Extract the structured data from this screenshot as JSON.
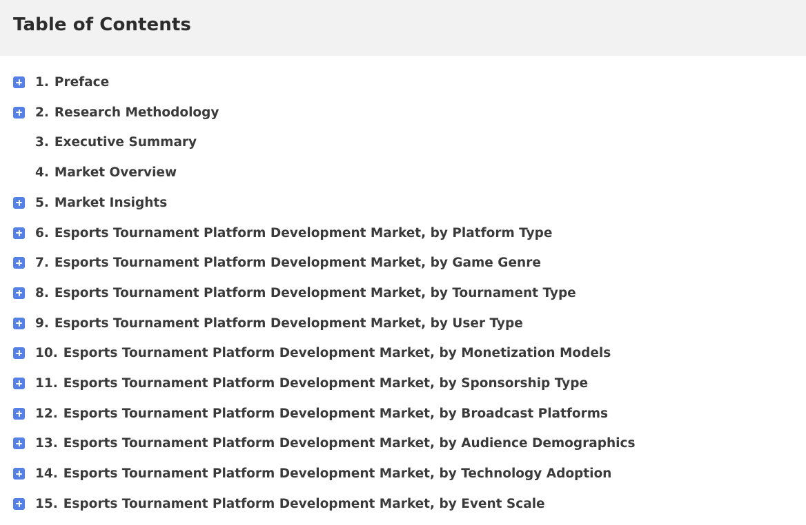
{
  "header": {
    "title": "Table of Contents"
  },
  "toc": {
    "items": [
      {
        "number": "1.",
        "label": "Preface",
        "expandable": true
      },
      {
        "number": "2.",
        "label": "Research Methodology",
        "expandable": true
      },
      {
        "number": "3.",
        "label": "Executive Summary",
        "expandable": false
      },
      {
        "number": "4.",
        "label": "Market Overview",
        "expandable": false
      },
      {
        "number": "5.",
        "label": "Market Insights",
        "expandable": true
      },
      {
        "number": "6.",
        "label": "Esports Tournament Platform Development Market, by Platform Type",
        "expandable": true
      },
      {
        "number": "7.",
        "label": "Esports Tournament Platform Development Market, by Game Genre",
        "expandable": true
      },
      {
        "number": "8.",
        "label": "Esports Tournament Platform Development Market, by Tournament Type",
        "expandable": true
      },
      {
        "number": "9.",
        "label": "Esports Tournament Platform Development Market, by User Type",
        "expandable": true
      },
      {
        "number": "10.",
        "label": "Esports Tournament Platform Development Market, by Monetization Models",
        "expandable": true
      },
      {
        "number": "11.",
        "label": "Esports Tournament Platform Development Market, by Sponsorship Type",
        "expandable": true
      },
      {
        "number": "12.",
        "label": "Esports Tournament Platform Development Market, by Broadcast Platforms",
        "expandable": true
      },
      {
        "number": "13.",
        "label": "Esports Tournament Platform Development Market, by Audience Demographics",
        "expandable": true
      },
      {
        "number": "14.",
        "label": "Esports Tournament Platform Development Market, by Technology Adoption",
        "expandable": true
      },
      {
        "number": "15.",
        "label": "Esports Tournament Platform Development Market, by Event Scale",
        "expandable": true
      }
    ]
  },
  "colors": {
    "expand_button": "#5580e6",
    "header_background": "#f2f2f2",
    "text": "#3a3a3a"
  },
  "icons": {
    "expand": "plus-square-icon"
  }
}
